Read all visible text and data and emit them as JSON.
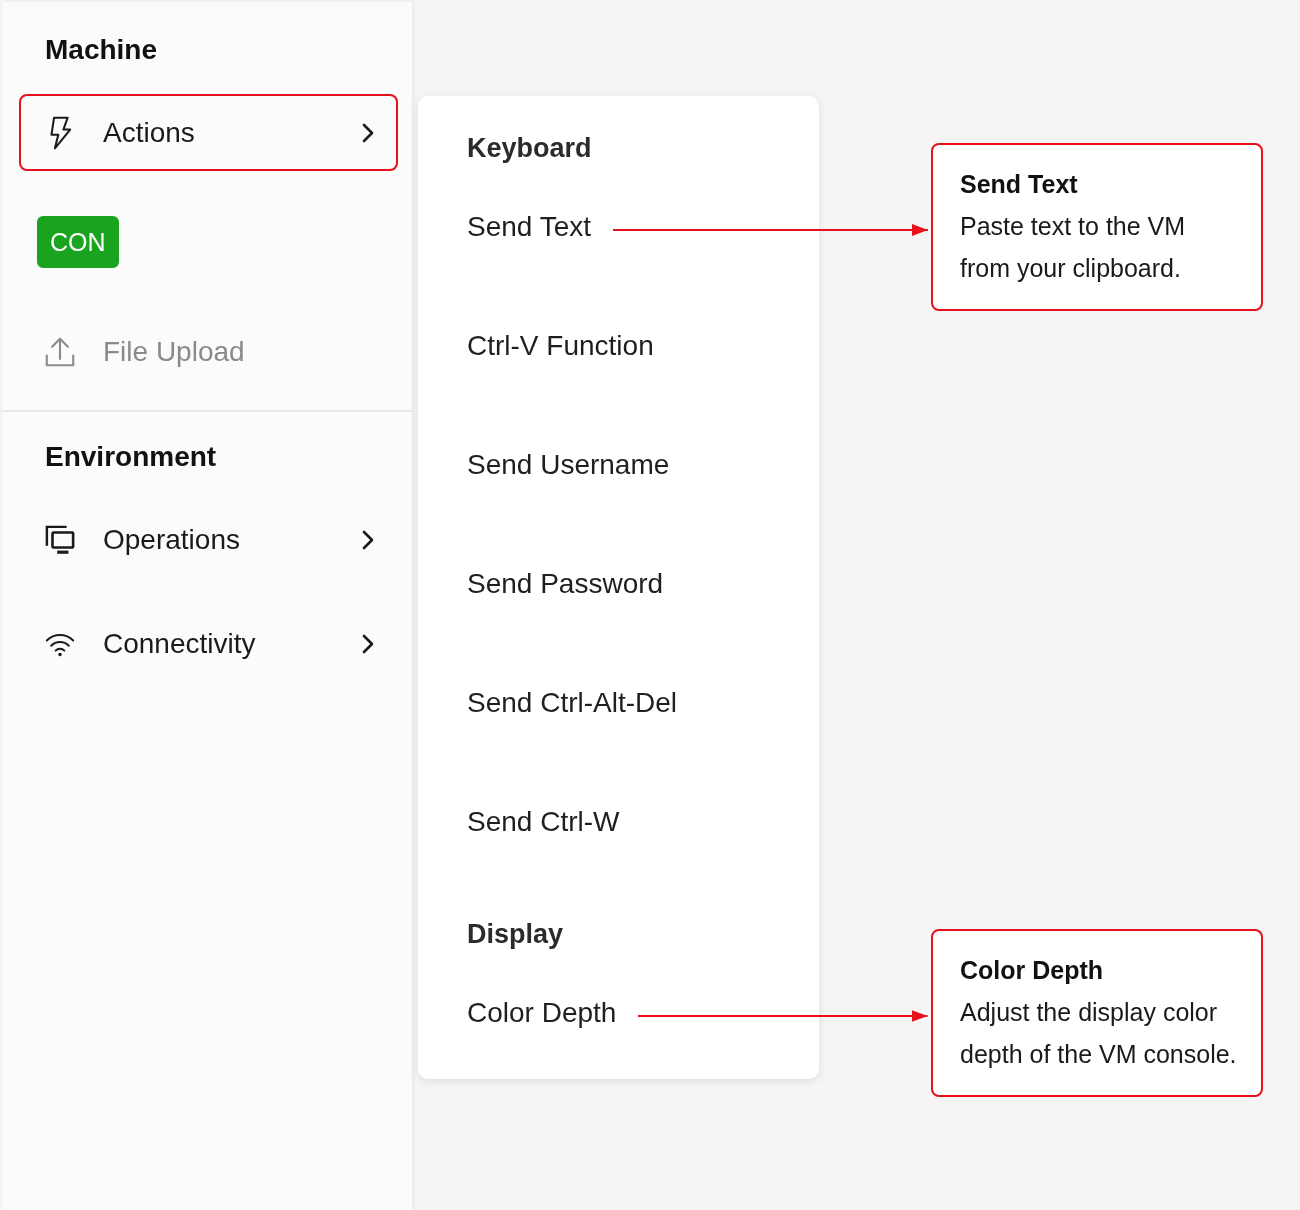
{
  "sidebar": {
    "sections": [
      {
        "title": "Machine",
        "items": [
          {
            "kind": "submenu",
            "label": "Actions",
            "selected": true,
            "disabled": false
          },
          {
            "kind": "badge",
            "label": "CON",
            "selected": false,
            "disabled": false
          },
          {
            "kind": "action",
            "label": "File Upload",
            "selected": false,
            "disabled": true
          }
        ]
      },
      {
        "title": "Environment",
        "items": [
          {
            "kind": "submenu",
            "label": "Operations",
            "selected": false,
            "disabled": false
          },
          {
            "kind": "submenu",
            "label": "Connectivity",
            "selected": false,
            "disabled": false
          }
        ]
      }
    ]
  },
  "submenu": {
    "groups": [
      {
        "title": "Keyboard",
        "items": [
          {
            "label": "Send Text",
            "callout": {
              "title": "Send Text",
              "text": "Paste text to the VM from your clipboard."
            }
          },
          {
            "label": "Ctrl-V Function"
          },
          {
            "label": "Send Username"
          },
          {
            "label": "Send Password"
          },
          {
            "label": "Send Ctrl-Alt-Del"
          },
          {
            "label": "Send Ctrl-W"
          }
        ]
      },
      {
        "title": "Display",
        "items": [
          {
            "label": "Color Depth",
            "callout": {
              "title": "Color Depth",
              "text": "Adjust the display color depth of the VM console."
            }
          }
        ]
      }
    ]
  }
}
